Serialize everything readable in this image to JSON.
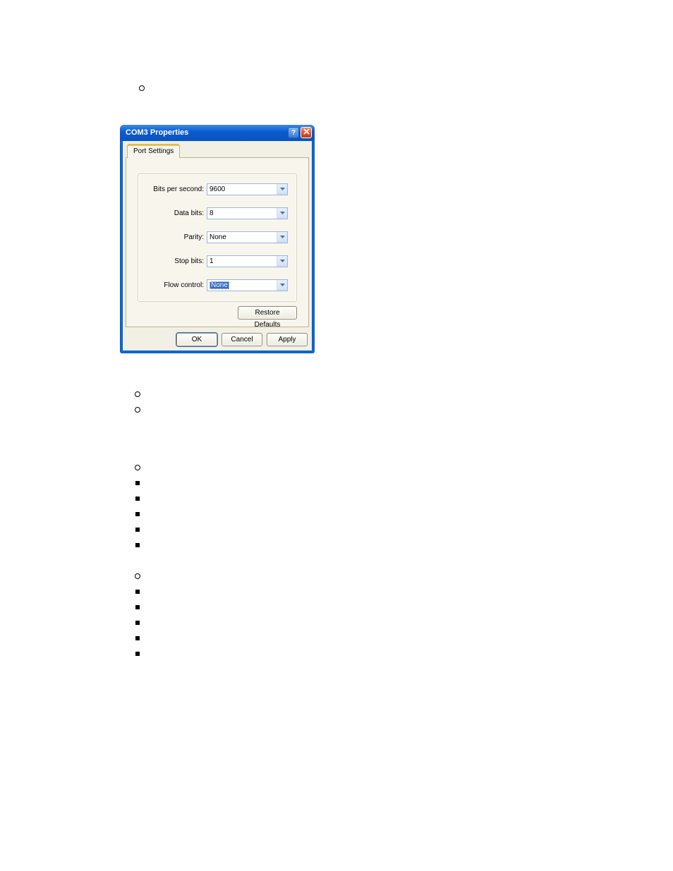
{
  "dialog": {
    "title": "COM3 Properties",
    "tab_label": "Port Settings",
    "fields": {
      "bits_per_second": {
        "label": "Bits per second:",
        "value": "9600"
      },
      "data_bits": {
        "label": "Data bits:",
        "value": "8"
      },
      "parity": {
        "label": "Parity:",
        "value": "None"
      },
      "stop_bits": {
        "label": "Stop bits:",
        "value": "1"
      },
      "flow_control": {
        "label": "Flow control:",
        "value": "None"
      }
    },
    "restore_defaults_label": "Restore Defaults",
    "ok_label": "OK",
    "cancel_label": "Cancel",
    "apply_label": "Apply"
  }
}
